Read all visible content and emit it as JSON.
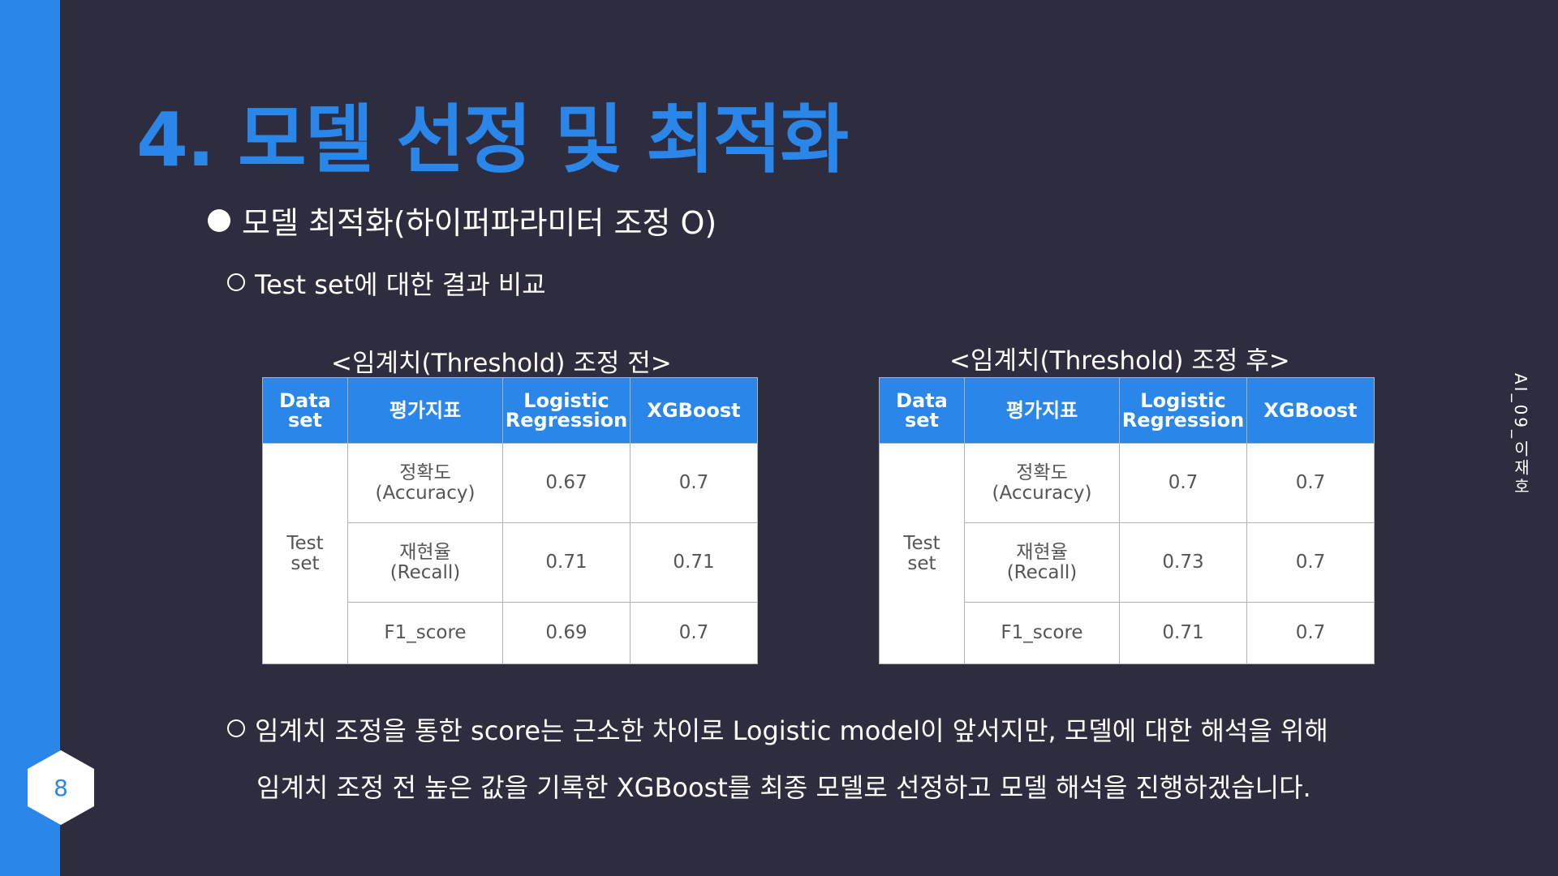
{
  "page_number": "8",
  "title": "4. 모델 선정 및 최적화",
  "bullet_main": "모델 최적화(하이퍼파라미터 조정 O)",
  "bullet_sub": "Test set에 대한 결과 비교",
  "side_label": "AI_09_이재호",
  "colors": {
    "accent": "#2b86e9",
    "background": "#2d2d3f"
  },
  "tables": [
    {
      "caption": "<임계치(Threshold) 조정 전>",
      "headers": {
        "dataset": [
          "Data",
          "set"
        ],
        "metric": "평가지표",
        "lr": [
          "Logistic",
          "Regression"
        ],
        "xgb": "XGBoost"
      },
      "dataset_label": [
        "Test",
        "set"
      ],
      "rows": [
        {
          "metric": [
            "정확도",
            "(Accuracy)"
          ],
          "lr": "0.67",
          "xgb": "0.7"
        },
        {
          "metric": [
            "재현율",
            "(Recall)"
          ],
          "lr": "0.71",
          "xgb": "0.71"
        },
        {
          "metric": [
            "F1_score"
          ],
          "lr": "0.69",
          "xgb": "0.7"
        }
      ]
    },
    {
      "caption": "<임계치(Threshold) 조정 후>",
      "headers": {
        "dataset": [
          "Data",
          "set"
        ],
        "metric": "평가지표",
        "lr": [
          "Logistic",
          "Regression"
        ],
        "xgb": "XGBoost"
      },
      "dataset_label": [
        "Test",
        "set"
      ],
      "rows": [
        {
          "metric": [
            "정확도",
            "(Accuracy)"
          ],
          "lr": "0.7",
          "xgb": "0.7"
        },
        {
          "metric": [
            "재현율",
            "(Recall)"
          ],
          "lr": "0.73",
          "xgb": "0.7"
        },
        {
          "metric": [
            "F1_score"
          ],
          "lr": "0.71",
          "xgb": "0.7"
        }
      ]
    }
  ],
  "conclusion_line1": "임계치 조정을 통한 score는 근소한 차이로 Logistic model이 앞서지만, 모델에 대한 해석을 위해",
  "conclusion_line2": "임계치 조정 전 높은 값을 기록한 XGBoost를 최종 모델로 선정하고 모델 해석을 진행하겠습니다."
}
